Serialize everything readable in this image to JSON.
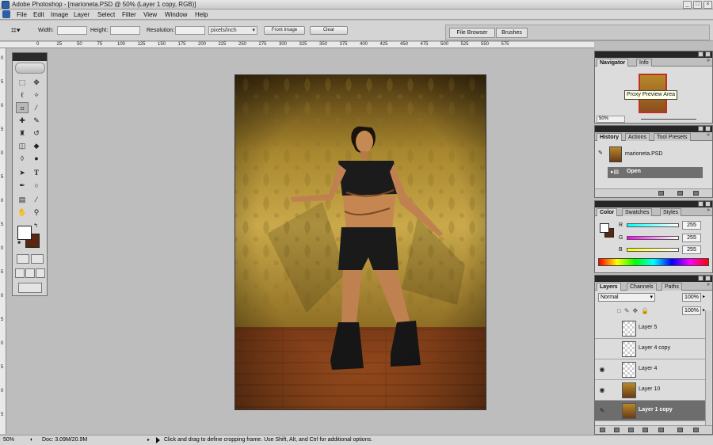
{
  "window": {
    "title": "Adobe Photoshop - [marioneta.PSD @ 50% (Layer 1 copy, RGB)]"
  },
  "menu": [
    "File",
    "Edit",
    "Image",
    "Layer",
    "Select",
    "Filter",
    "View",
    "Window",
    "Help"
  ],
  "options": {
    "width_label": "Width:",
    "height_label": "Height:",
    "resolution_label": "Resolution:",
    "units": "pixels/inch",
    "front_image": "Front Image",
    "clear": "Clear"
  },
  "well_tabs": [
    "File Browser",
    "Brushes"
  ],
  "rulers": {
    "h_ticks": [
      "0",
      "25",
      "50",
      "75",
      "100",
      "125",
      "150",
      "175",
      "200",
      "225",
      "250",
      "275",
      "300",
      "325",
      "350",
      "375",
      "400",
      "425",
      "450",
      "475",
      "500",
      "525",
      "550",
      "575"
    ],
    "v_ticks": [
      "0",
      "5",
      "0",
      "5",
      "0",
      "5",
      "0",
      "5",
      "0",
      "5",
      "0",
      "5",
      "0",
      "5",
      "0",
      "5"
    ]
  },
  "navigator": {
    "tabs": [
      "Navigator",
      "Info"
    ],
    "tooltip": "Proxy Preview Area",
    "zoom": "50%"
  },
  "history": {
    "tabs": [
      "History",
      "Actions",
      "Tool Presets"
    ],
    "snapshot": "marioneta.PSD",
    "state": "Open"
  },
  "color": {
    "tabs": [
      "Color",
      "Swatches",
      "Styles"
    ],
    "channels": [
      {
        "label": "R",
        "value": "255",
        "gradient": "linear-gradient(90deg,#00ffff,#ffffff)"
      },
      {
        "label": "G",
        "value": "255",
        "gradient": "linear-gradient(90deg,#ff00ff,#ffffff)"
      },
      {
        "label": "B",
        "value": "255",
        "gradient": "linear-gradient(90deg,#ffff00,#ffffff)"
      }
    ]
  },
  "layers": {
    "tabs": [
      "Layers",
      "Channels",
      "Paths"
    ],
    "blend_mode": "Normal",
    "opacity": "100%",
    "fill": "100%",
    "items": [
      {
        "name": "Layer 5",
        "visible": false,
        "photo": false,
        "selected": false
      },
      {
        "name": "Layer 4 copy",
        "visible": false,
        "photo": false,
        "selected": false
      },
      {
        "name": "Layer 4",
        "visible": true,
        "photo": false,
        "selected": false
      },
      {
        "name": "Layer 10",
        "visible": true,
        "photo": true,
        "selected": false
      },
      {
        "name": "Layer 1 copy",
        "visible": false,
        "photo": true,
        "selected": true
      }
    ]
  },
  "status": {
    "zoom": "50%",
    "doc": "Doc: 3.09M/20.9M",
    "hint": "Click and drag to define cropping frame. Use Shift, Alt, and Ctrl for additional options."
  },
  "colors": {
    "foreground": "#ffffff",
    "background": "#5a2712",
    "selected_layer": "#6d6d6d"
  }
}
